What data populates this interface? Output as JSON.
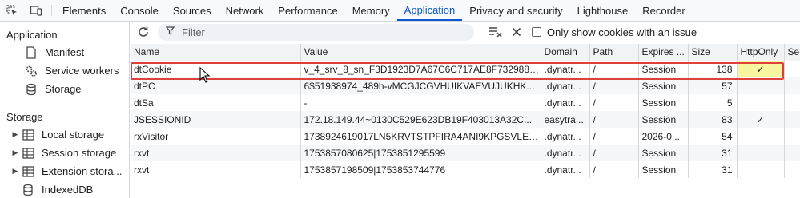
{
  "tabs": [
    {
      "label": "Elements"
    },
    {
      "label": "Console"
    },
    {
      "label": "Sources"
    },
    {
      "label": "Network"
    },
    {
      "label": "Performance"
    },
    {
      "label": "Memory"
    },
    {
      "label": "Application",
      "active": true
    },
    {
      "label": "Privacy and security"
    },
    {
      "label": "Lighthouse"
    },
    {
      "label": "Recorder"
    }
  ],
  "sidebar": {
    "application_heading": "Application",
    "app_items": [
      {
        "label": "Manifest",
        "icon": "document-icon"
      },
      {
        "label": "Service workers",
        "icon": "gears-icon"
      },
      {
        "label": "Storage",
        "icon": "database-icon"
      }
    ],
    "storage_heading": "Storage",
    "storage_items": [
      {
        "label": "Local storage",
        "icon": "table-icon"
      },
      {
        "label": "Session storage",
        "icon": "table-icon"
      },
      {
        "label": "Extension stora...",
        "icon": "table-icon"
      },
      {
        "label": "IndexedDB",
        "icon": "database-icon"
      }
    ]
  },
  "toolbar": {
    "filter_placeholder": "Filter",
    "only_issues_label": "Only show cookies with an issue"
  },
  "table": {
    "columns": [
      "Name",
      "Value",
      "Domain",
      "Path",
      "Expires ...",
      "Size",
      "HttpOnly",
      "Se"
    ],
    "rows": [
      {
        "name": "dtCookie",
        "value": "v_4_srv_8_sn_F3D1923D7A67C6C717AE8F732988B...",
        "domain": ".dynatr...",
        "path": "/",
        "expires": "Session",
        "size": "138",
        "httponly": "✓"
      },
      {
        "name": "dtPC",
        "value": "6$51938974_489h-vMCGJCGVHUIKVAEVUJUKHK...",
        "domain": ".dynatr...",
        "path": "/",
        "expires": "Session",
        "size": "57",
        "httponly": ""
      },
      {
        "name": "dtSa",
        "value": "-",
        "domain": ".dynatr...",
        "path": "/",
        "expires": "Session",
        "size": "5",
        "httponly": ""
      },
      {
        "name": "JSESSIONID",
        "value": "172.18.149.44~0130C529E623DB19F403013A32C...",
        "domain": "easytra...",
        "path": "/",
        "expires": "Session",
        "size": "83",
        "httponly": "✓"
      },
      {
        "name": "rxVisitor",
        "value": "1738924619017LN5KRVTSTPFIRA4ANI9KPGSVLE0...",
        "domain": ".dynatr...",
        "path": "/",
        "expires": "2026-0...",
        "size": "54",
        "httponly": ""
      },
      {
        "name": "rxvt",
        "value": "1753857080625|1753851295599",
        "domain": ".dynatr...",
        "path": "/",
        "expires": "Session",
        "size": "31",
        "httponly": ""
      },
      {
        "name": "rxvt",
        "value": "1753857198509|1753853744776",
        "domain": ".dynatr...",
        "path": "/",
        "expires": "Session",
        "size": "31",
        "httponly": ""
      }
    ]
  },
  "colors": {
    "accent": "#0b57d0",
    "highlight": "#f7f5a0",
    "selection_outline": "#e0403a"
  }
}
